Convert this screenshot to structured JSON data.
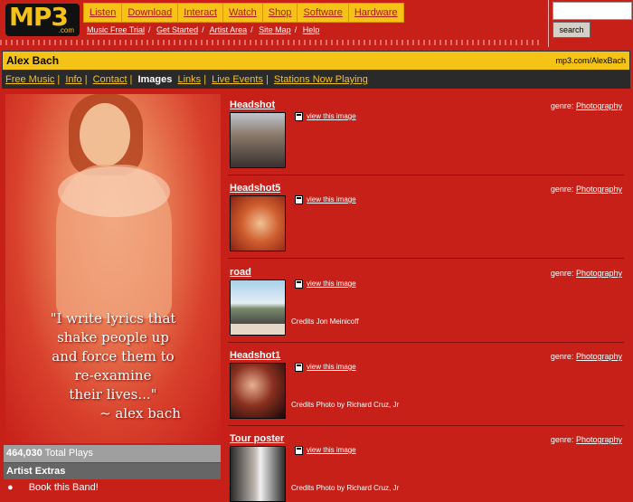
{
  "logo": {
    "text": "MP3",
    "suffix": ".com"
  },
  "topnav": [
    "Listen",
    "Download",
    "Interact",
    "Watch",
    "Shop",
    "Software",
    "Hardware"
  ],
  "subnav": [
    "Music Free Trial",
    "Get Started",
    "Artist Area",
    "Site Map",
    "Help"
  ],
  "search": {
    "value": "",
    "button_label": "search"
  },
  "artist": {
    "name": "Alex Bach",
    "url": "mp3.com/AlexBach"
  },
  "tabs": [
    "Free Music",
    "Info",
    "Contact",
    "Images",
    "Links",
    "Live Events",
    "Stations Now Playing"
  ],
  "active_tab": "Images",
  "promo": {
    "quote_lines": [
      "\"I write lyrics that",
      "shake people up",
      "and force them to",
      "re-examine",
      "their lives...\"",
      "~ alex bach"
    ]
  },
  "stats": {
    "plays_count": "464,030",
    "plays_label": "Total Plays"
  },
  "extras": {
    "heading": "Artist Extras",
    "links": [
      "Book this Band!"
    ]
  },
  "images": [
    {
      "title": "Headshot",
      "genre_label": "genre:",
      "genre": "Photography",
      "view_label": "view this image",
      "credits": ""
    },
    {
      "title": "Headshot5",
      "genre_label": "genre:",
      "genre": "Photography",
      "view_label": "view this image",
      "credits": ""
    },
    {
      "title": "road",
      "genre_label": "genre:",
      "genre": "Photography",
      "view_label": "view this image",
      "credits": "Credits Jon Meinicoff"
    },
    {
      "title": "Headshot1",
      "genre_label": "genre:",
      "genre": "Photography",
      "view_label": "view this image",
      "credits": "Credits Photo by Richard Cruz, Jr"
    },
    {
      "title": "Tour poster",
      "genre_label": "genre:",
      "genre": "Photography",
      "view_label": "view this image",
      "credits": "Credits Photo by Richard Cruz, Jr"
    }
  ],
  "colors": {
    "background": "#c72019",
    "accent": "#f5c315",
    "dark": "#2a2a2a"
  }
}
